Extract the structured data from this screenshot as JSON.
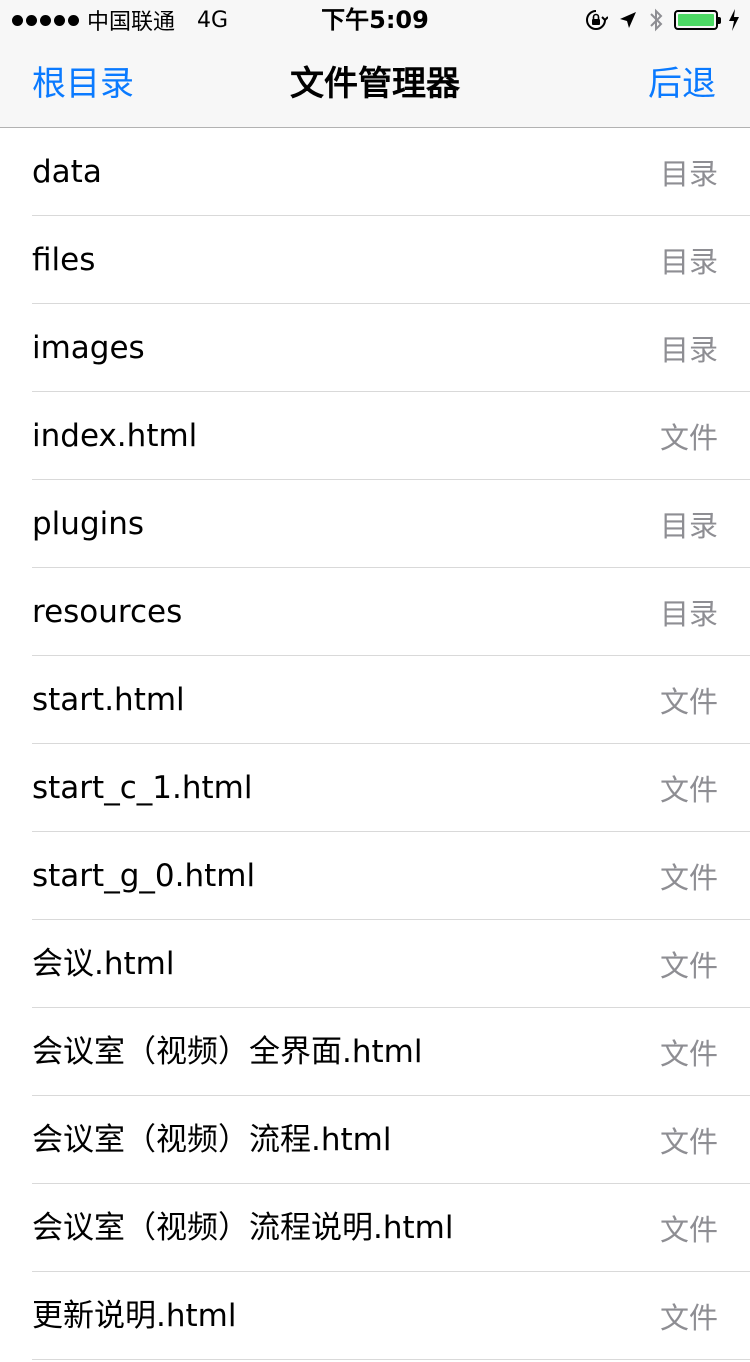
{
  "status_bar": {
    "carrier": "中国联通",
    "network": "4G",
    "time": "下午5:09",
    "battery_color": "#4cd964"
  },
  "nav": {
    "left_label": "根目录",
    "title": "文件管理器",
    "right_label": "后退",
    "accent_color": "#0a7aff"
  },
  "files": [
    {
      "name": "data",
      "type": "目录"
    },
    {
      "name": "files",
      "type": "目录"
    },
    {
      "name": "images",
      "type": "目录"
    },
    {
      "name": "index.html",
      "type": "文件"
    },
    {
      "name": "plugins",
      "type": "目录"
    },
    {
      "name": "resources",
      "type": "目录"
    },
    {
      "name": "start.html",
      "type": "文件"
    },
    {
      "name": "start_c_1.html",
      "type": "文件"
    },
    {
      "name": "start_g_0.html",
      "type": "文件"
    },
    {
      "name": "会议.html",
      "type": "文件"
    },
    {
      "name": "会议室（视频）全界面.html",
      "type": "文件"
    },
    {
      "name": "会议室（视频）流程.html",
      "type": "文件"
    },
    {
      "name": "会议室（视频）流程说明.html",
      "type": "文件"
    },
    {
      "name": "更新说明.html",
      "type": "文件"
    }
  ]
}
